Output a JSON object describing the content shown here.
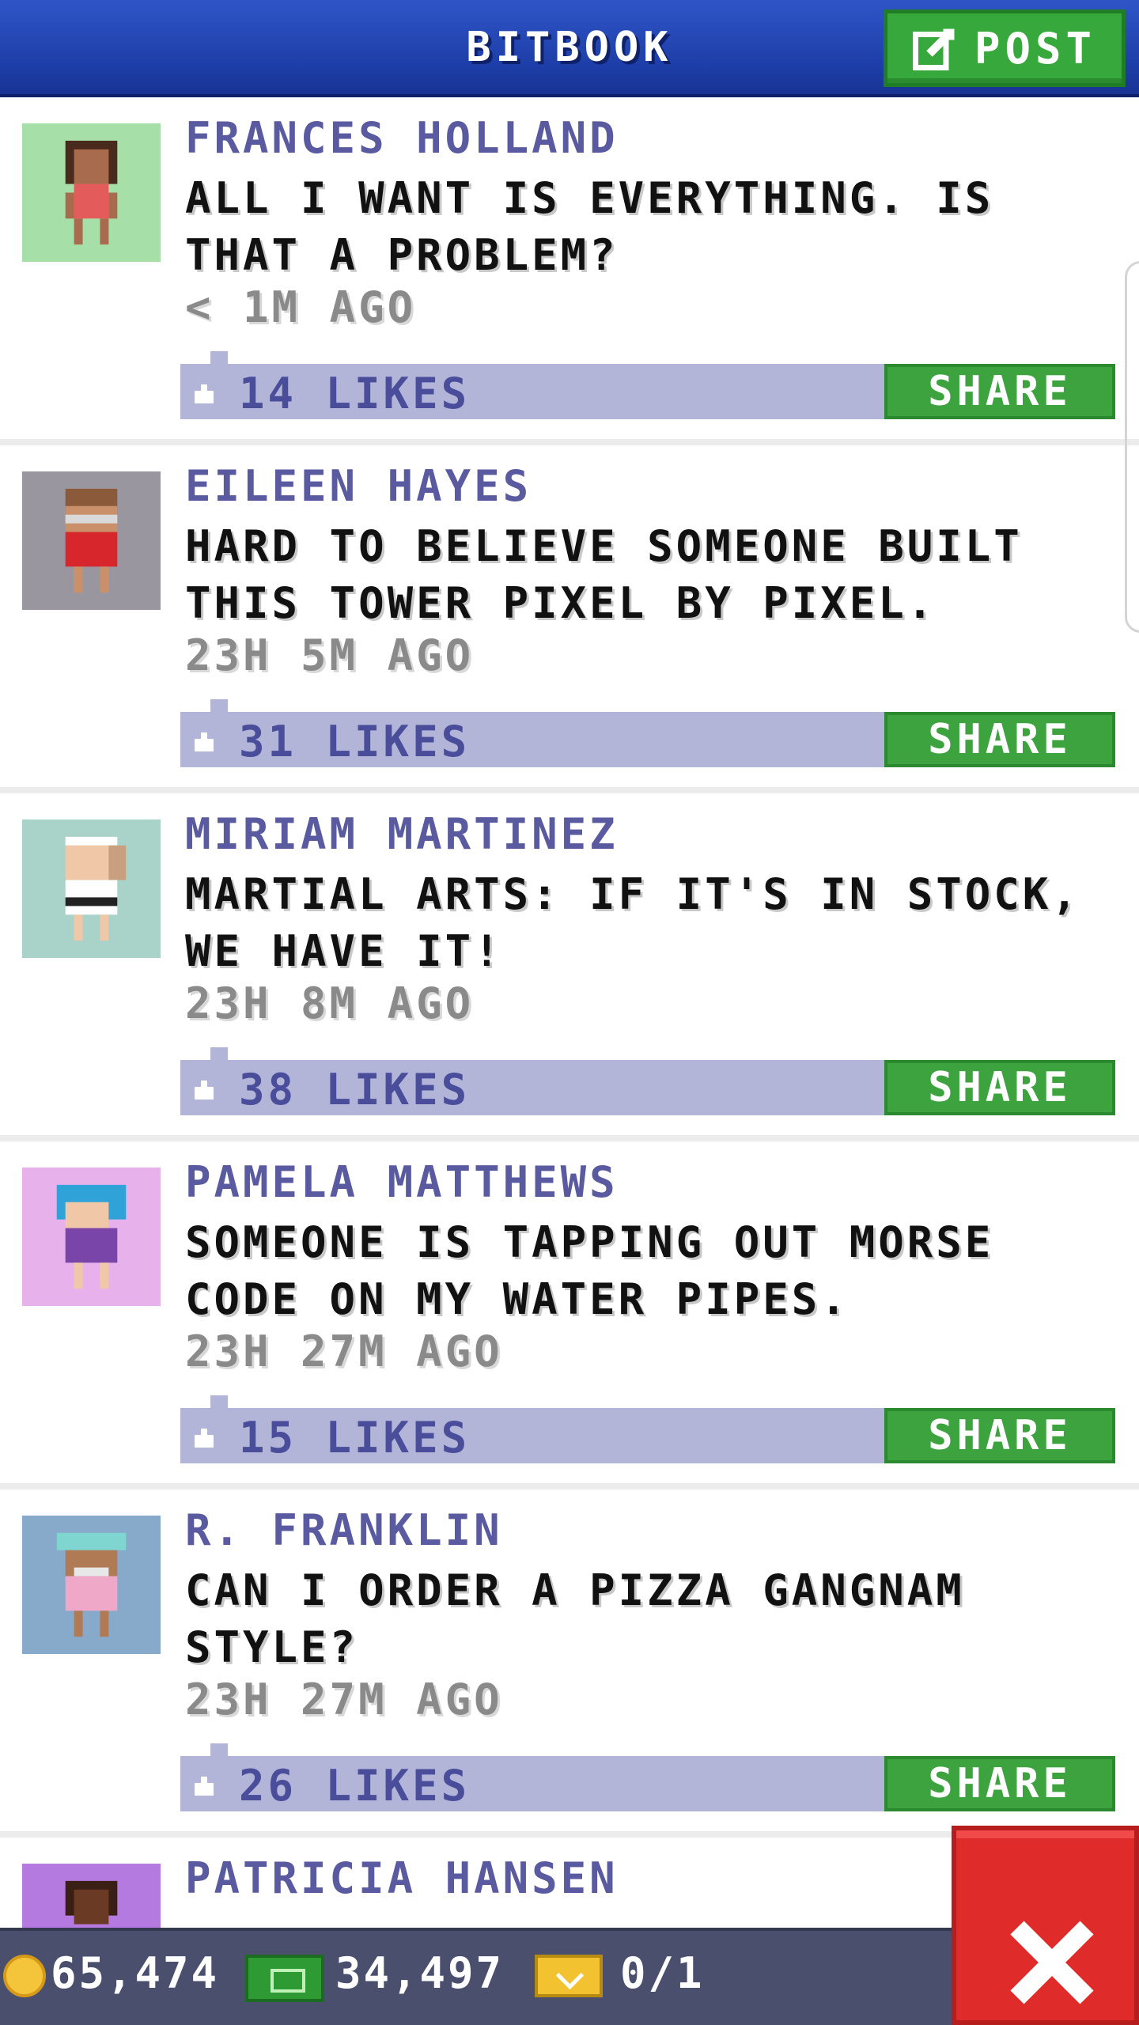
{
  "header": {
    "title": "BITBOOK",
    "post_label": "POST"
  },
  "posts": [
    {
      "author": "FRANCES HOLLAND",
      "message": "ALL I WANT IS EVERYTHING. IS THAT A PROBLEM?",
      "time": "< 1M AGO",
      "likes": "14 LIKES",
      "share": "SHARE",
      "avatar_bg": "#a7dfa9"
    },
    {
      "author": "EILEEN HAYES",
      "message": "HARD TO BELIEVE SOMEONE BUILT THIS TOWER PIXEL BY PIXEL.",
      "time": "23H 5M AGO",
      "likes": "31 LIKES",
      "share": "SHARE",
      "avatar_bg": "#9a96a0"
    },
    {
      "author": "MIRIAM MARTINEZ",
      "message": "MARTIAL ARTS: IF IT'S IN STOCK, WE HAVE IT!",
      "time": "23H 8M AGO",
      "likes": "38 LIKES",
      "share": "SHARE",
      "avatar_bg": "#a9d2c8"
    },
    {
      "author": "PAMELA MATTHEWS",
      "message": "SOMEONE IS TAPPING OUT MORSE CODE ON MY WATER PIPES.",
      "time": "23H 27M AGO",
      "likes": "15 LIKES",
      "share": "SHARE",
      "avatar_bg": "#e7b2ec"
    },
    {
      "author": "R. FRANKLIN",
      "message": "CAN I ORDER A PIZZA GANGNAM STYLE?",
      "time": "23H 27M AGO",
      "likes": "26 LIKES",
      "share": "SHARE",
      "avatar_bg": "#87aacb"
    },
    {
      "author": "PATRICIA HANSEN",
      "avatar_bg": "#b47ae0"
    }
  ],
  "status": {
    "coins": "65,474",
    "cash": "34,497",
    "tickets": "0/1"
  }
}
